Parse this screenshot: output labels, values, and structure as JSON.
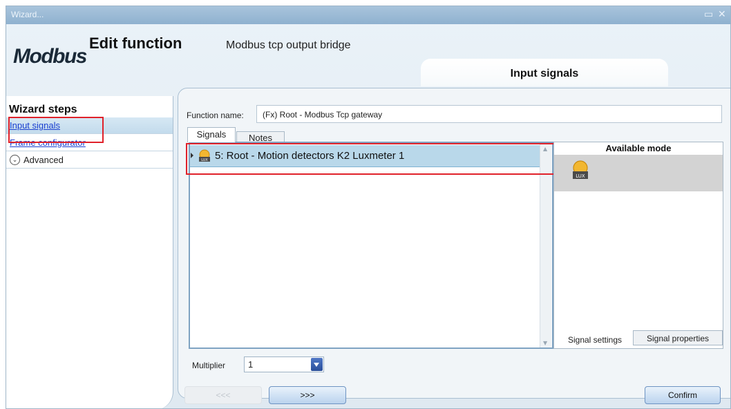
{
  "window": {
    "title": "Wizard...",
    "maximize_icon": "maximize-icon",
    "close_icon": "close-icon"
  },
  "header": {
    "logo_text": "Modbus",
    "title": "Edit function",
    "subtitle": "Modbus tcp output bridge",
    "current_step": "Input signals"
  },
  "sidebar": {
    "heading": "Wizard steps",
    "items": [
      {
        "label": "Input signals",
        "selected": true
      },
      {
        "label": "Frame configurator",
        "selected": false
      }
    ],
    "advanced_label": "Advanced"
  },
  "main": {
    "function_name_label": "Function name:",
    "function_name_value": "(Fx) Root - Modbus Tcp gateway",
    "tabs": [
      {
        "label": "Signals",
        "active": true
      },
      {
        "label": "Notes",
        "active": false
      }
    ],
    "signals": [
      {
        "text": "5: Root - Motion detectors K2 Luxmeter 1",
        "icon": "luxmeter-icon"
      }
    ],
    "available_mode_header": "Available mode",
    "available_mode_icon": "luxmeter-icon",
    "icon_lux_text": "LUX",
    "mode_tabs": [
      {
        "label": "Signal settings",
        "active": true
      },
      {
        "label": "Signal properties",
        "active": false
      }
    ],
    "multiplier_label": "Multiplier",
    "multiplier_value": "1"
  },
  "footer": {
    "prev_label": "<<<",
    "next_label": ">>>",
    "confirm_label": "Confirm"
  },
  "colors": {
    "highlight_box": "#e0212a",
    "selected_row": "#b9d8ea",
    "link": "#1a3fd0"
  }
}
